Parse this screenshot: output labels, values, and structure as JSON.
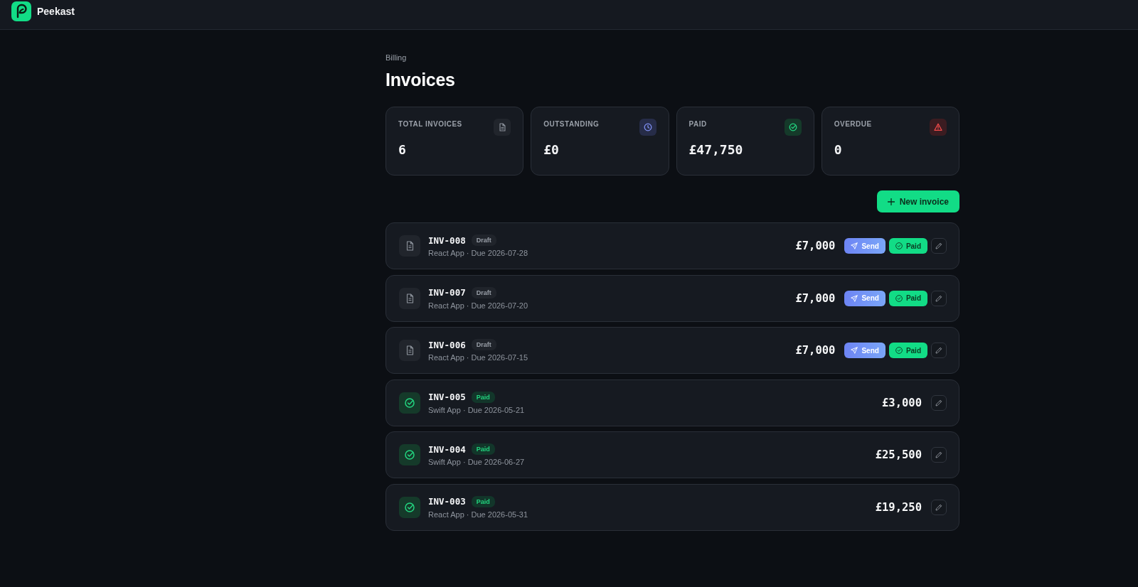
{
  "app": {
    "name": "Peekast"
  },
  "page": {
    "breadcrumb": "Billing",
    "title": "Invoices"
  },
  "stats": [
    {
      "kind": "total",
      "label": "TOTAL INVOICES",
      "value": "6"
    },
    {
      "kind": "outstanding",
      "label": "OUTSTANDING",
      "value": "£0"
    },
    {
      "kind": "paid",
      "label": "PAID",
      "value": "£47,750"
    },
    {
      "kind": "overdue",
      "label": "OVERDUE",
      "value": "0"
    }
  ],
  "new_invoice_button": {
    "label": "New invoice"
  },
  "invoices": [
    {
      "kind": "draft",
      "number": "INV-008",
      "status": "Draft",
      "meta": "React App · Due 2026-07-28",
      "amount": "£7,000",
      "actions": [
        {
          "kind": "send",
          "label": "Send"
        },
        {
          "kind": "paid",
          "label": "Paid"
        }
      ]
    },
    {
      "kind": "draft",
      "number": "INV-007",
      "status": "Draft",
      "meta": "React App · Due 2026-07-20",
      "amount": "£7,000",
      "actions": [
        {
          "kind": "send",
          "label": "Send"
        },
        {
          "kind": "paid",
          "label": "Paid"
        }
      ]
    },
    {
      "kind": "draft",
      "number": "INV-006",
      "status": "Draft",
      "meta": "React App · Due 2026-07-15",
      "amount": "£7,000",
      "actions": [
        {
          "kind": "send",
          "label": "Send"
        },
        {
          "kind": "paid",
          "label": "Paid"
        }
      ]
    },
    {
      "kind": "paid",
      "number": "INV-005",
      "status": "Paid",
      "meta": "Swift App · Due 2026-05-21",
      "amount": "£3,000"
    },
    {
      "kind": "paid",
      "number": "INV-004",
      "status": "Paid",
      "meta": "Swift App · Due 2026-06-27",
      "amount": "£25,500"
    },
    {
      "kind": "paid",
      "number": "INV-003",
      "status": "Paid",
      "meta": "React App · Due 2026-05-31",
      "amount": "£19,250"
    }
  ]
}
